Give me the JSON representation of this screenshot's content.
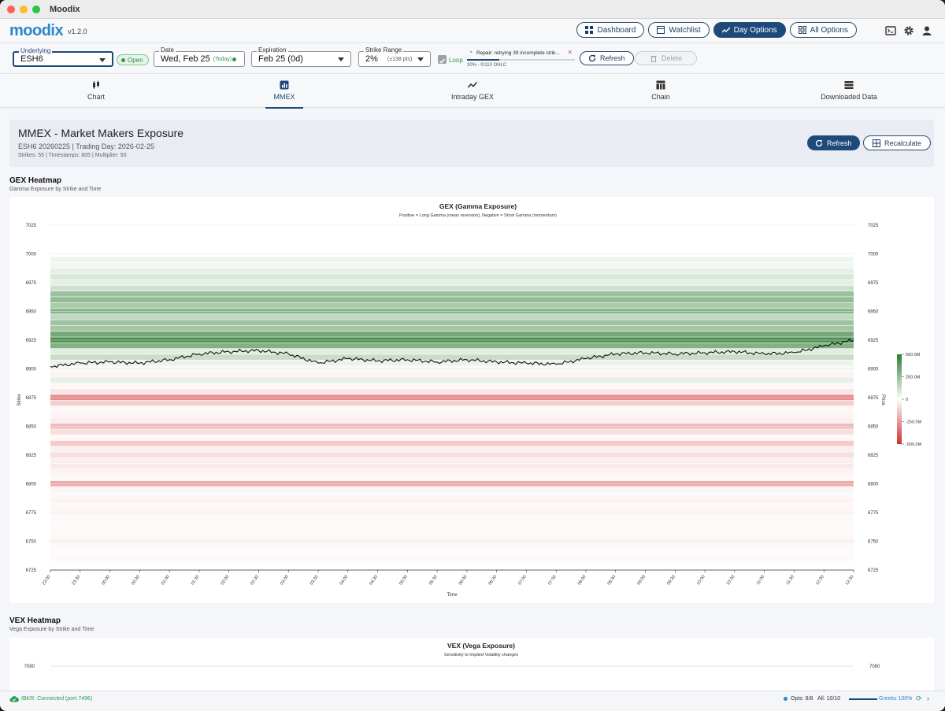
{
  "window": {
    "title": "Moodix"
  },
  "app": {
    "logo": "moodix",
    "version": "v1.2.0"
  },
  "nav": [
    {
      "label": "Dashboard",
      "icon": "dashboard-icon",
      "active": false
    },
    {
      "label": "Watchlist",
      "icon": "watchlist-icon",
      "active": false
    },
    {
      "label": "Day Options",
      "icon": "trend-icon",
      "active": true
    },
    {
      "label": "All Options",
      "icon": "grid-icon",
      "active": false
    }
  ],
  "controls": {
    "underlying": {
      "label": "Underlying",
      "value": "ESH6"
    },
    "market_status": "Open",
    "date": {
      "label": "Date",
      "value": "Wed, Feb 25",
      "tag": "(Today)"
    },
    "expiration": {
      "label": "Expiration",
      "value": "Feb 25 (0d)"
    },
    "strike_range": {
      "label": "Strike Range",
      "value": "2%",
      "hint": "(±138 pts)"
    },
    "loop_label": "Loop",
    "repair_text": "Repair: retrying 39 incomplete strik...",
    "repair_progress_text": "30% - 0/110 OHLC",
    "repair_progress": 0.3,
    "refresh_label": "Refresh",
    "delete_label": "Delete"
  },
  "tabs": [
    {
      "label": "Chart",
      "icon": "candles-icon"
    },
    {
      "label": "MMEX",
      "icon": "bar-chart-icon",
      "active": true
    },
    {
      "label": "Intraday GEX",
      "icon": "line-icon"
    },
    {
      "label": "Chain",
      "icon": "table-icon"
    },
    {
      "label": "Downloaded Data",
      "icon": "list-icon"
    }
  ],
  "panel": {
    "title": "MMEX - Market Makers Exposure",
    "subtitle": "ESH6 20260225 | Trading Day: 2026-02-25",
    "meta": "Strikes: 55 | Timestamps: 805 | Multiplier: 50",
    "refresh_label": "Refresh",
    "recalc_label": "Recalculate"
  },
  "gex_section": {
    "title": "GEX Heatmap",
    "subtitle": "Gamma Exposure by Strike and Time"
  },
  "vex_section": {
    "title": "VEX Heatmap",
    "subtitle": "Vega Exposure by Strike and Time"
  },
  "chart_data": [
    {
      "type": "heatmap",
      "title": "GEX (Gamma Exposure)",
      "subtitle": "Positive = Long Gamma (mean reversion), Negative = Short Gamma (momentum)",
      "xlabel": "Time",
      "ylabel": "Strike",
      "y2label": "Price",
      "x": [
        "23:00",
        "23:30",
        "00:00",
        "00:30",
        "01:00",
        "01:30",
        "02:00",
        "02:30",
        "03:00",
        "03:30",
        "04:00",
        "04:30",
        "05:00",
        "05:30",
        "06:00",
        "06:30",
        "07:00",
        "07:30",
        "08:00",
        "08:30",
        "09:00",
        "09:30",
        "10:00",
        "10:30",
        "11:00",
        "11:30",
        "12:00",
        "12:30"
      ],
      "yticks": [
        6725,
        6750,
        6775,
        6800,
        6825,
        6850,
        6875,
        6900,
        6925,
        6950,
        6975,
        7000,
        7025
      ],
      "ylim": [
        6725,
        7025
      ],
      "colorbar": {
        "ticks": [
          "500.0M",
          "250.0M",
          "0",
          "-250.0M",
          "-500.0M"
        ],
        "range": [
          -500,
          500
        ],
        "positive_color": "#2e7d32",
        "negative_color": "#d32f2f"
      },
      "strike_exposure": [
        {
          "strike": 6995,
          "value": 40
        },
        {
          "strike": 6990,
          "value": 30
        },
        {
          "strike": 6985,
          "value": 60
        },
        {
          "strike": 6980,
          "value": 90
        },
        {
          "strike": 6975,
          "value": 60
        },
        {
          "strike": 6970,
          "value": 120
        },
        {
          "strike": 6965,
          "value": 240
        },
        {
          "strike": 6960,
          "value": 260
        },
        {
          "strike": 6955,
          "value": 200
        },
        {
          "strike": 6950,
          "value": 280
        },
        {
          "strike": 6945,
          "value": 150
        },
        {
          "strike": 6940,
          "value": 230
        },
        {
          "strike": 6935,
          "value": 220
        },
        {
          "strike": 6930,
          "value": 330
        },
        {
          "strike": 6925,
          "value": 430
        },
        {
          "strike": 6920,
          "value": 300
        },
        {
          "strike": 6915,
          "value": 70
        },
        {
          "strike": 6910,
          "value": 130
        },
        {
          "strike": 6905,
          "value": 50
        },
        {
          "strike": 6900,
          "value": 20
        },
        {
          "strike": 6895,
          "value": -30
        },
        {
          "strike": 6890,
          "value": 60
        },
        {
          "strike": 6885,
          "value": -20
        },
        {
          "strike": 6880,
          "value": -60
        },
        {
          "strike": 6875,
          "value": -280
        },
        {
          "strike": 6870,
          "value": -120
        },
        {
          "strike": 6865,
          "value": -20
        },
        {
          "strike": 6860,
          "value": -30
        },
        {
          "strike": 6855,
          "value": -40
        },
        {
          "strike": 6850,
          "value": -160
        },
        {
          "strike": 6845,
          "value": -80
        },
        {
          "strike": 6840,
          "value": -20
        },
        {
          "strike": 6835,
          "value": -130
        },
        {
          "strike": 6830,
          "value": -40
        },
        {
          "strike": 6825,
          "value": -80
        },
        {
          "strike": 6820,
          "value": -40
        },
        {
          "strike": 6815,
          "value": -50
        },
        {
          "strike": 6810,
          "value": -30
        },
        {
          "strike": 6805,
          "value": -20
        },
        {
          "strike": 6800,
          "value": -200
        },
        {
          "strike": 6795,
          "value": -30
        },
        {
          "strike": 6790,
          "value": -20
        },
        {
          "strike": 6785,
          "value": -30
        },
        {
          "strike": 6780,
          "value": -20
        },
        {
          "strike": 6775,
          "value": -25
        },
        {
          "strike": 6770,
          "value": -20
        },
        {
          "strike": 6765,
          "value": -15
        },
        {
          "strike": 6760,
          "value": -20
        },
        {
          "strike": 6755,
          "value": -15
        },
        {
          "strike": 6750,
          "value": -30
        },
        {
          "strike": 6745,
          "value": -15
        },
        {
          "strike": 6740,
          "value": -10
        },
        {
          "strike": 6735,
          "value": -15
        }
      ],
      "price_series": {
        "x": [
          0,
          1,
          2,
          3,
          4,
          5,
          6,
          7,
          8,
          9,
          10,
          11,
          12,
          13,
          14,
          15,
          16,
          17,
          18,
          19,
          20,
          21,
          22,
          23,
          24,
          25,
          26,
          27
        ],
        "y": [
          6902,
          6905,
          6906,
          6905,
          6908,
          6913,
          6915,
          6916,
          6913,
          6905,
          6909,
          6907,
          6908,
          6906,
          6908,
          6906,
          6905,
          6904,
          6909,
          6913,
          6914,
          6913,
          6914,
          6915,
          6913,
          6914,
          6920,
          6925
        ]
      }
    },
    {
      "type": "heatmap",
      "title": "VEX (Vega Exposure)",
      "subtitle": "Sensitivity to Implied Volatility changes",
      "yticks": [
        7080
      ]
    }
  ],
  "status": {
    "connection": "IBKR: Connected (port 7496)",
    "opts": "Opts: 8/8",
    "all": "All: 10/10",
    "greeks": "Greeks 100%"
  }
}
